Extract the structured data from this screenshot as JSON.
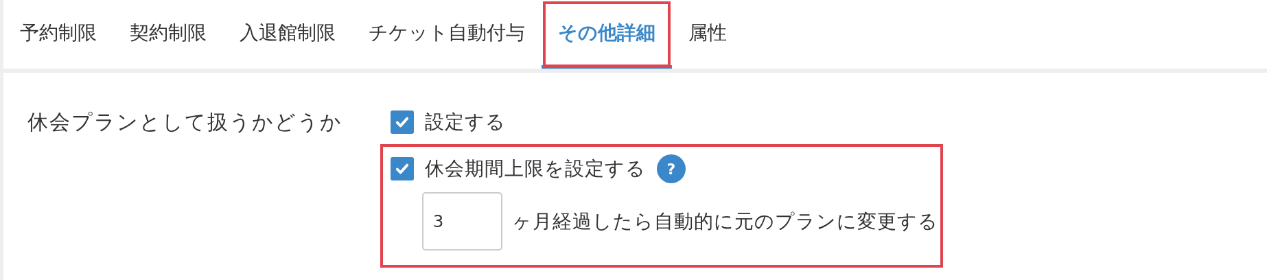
{
  "tabs": [
    {
      "label": "予約制限",
      "selected": false,
      "highlighted": false
    },
    {
      "label": "契約制限",
      "selected": false,
      "highlighted": false
    },
    {
      "label": "入退館制限",
      "selected": false,
      "highlighted": false
    },
    {
      "label": "チケット自動付与",
      "selected": false,
      "highlighted": false
    },
    {
      "label": "その他詳細",
      "selected": true,
      "highlighted": true
    },
    {
      "label": "属性",
      "selected": false,
      "highlighted": false
    }
  ],
  "setting": {
    "label": "休会プランとして扱うかどうか",
    "enable": {
      "label": "設定する",
      "checked": true
    },
    "limit_group": {
      "highlighted": true,
      "limit": {
        "label": "休会期間上限を設定する",
        "checked": true,
        "help": "?"
      },
      "months": {
        "value": "3",
        "suffix": "ヶ月経過したら自動的に元のプランに変更する"
      }
    }
  }
}
